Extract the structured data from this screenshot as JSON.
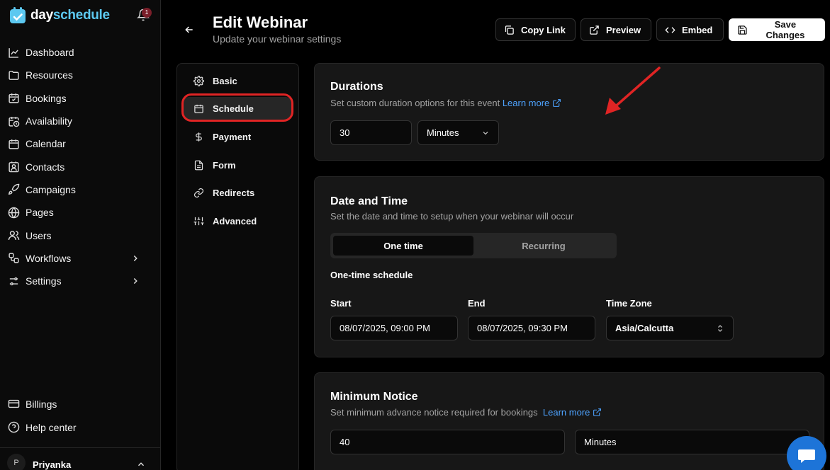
{
  "brand": {
    "part1": "day",
    "part2": "schedule"
  },
  "notifications": {
    "count": "1"
  },
  "sidebar": {
    "items": [
      {
        "label": "Dashboard",
        "icon": "chart-line-icon"
      },
      {
        "label": "Resources",
        "icon": "folder-icon"
      },
      {
        "label": "Bookings",
        "icon": "calendar-check-icon"
      },
      {
        "label": "Availability",
        "icon": "calendar-clock-icon"
      },
      {
        "label": "Calendar",
        "icon": "calendar-icon"
      },
      {
        "label": "Contacts",
        "icon": "contact-icon"
      },
      {
        "label": "Campaigns",
        "icon": "rocket-icon"
      },
      {
        "label": "Pages",
        "icon": "globe-icon"
      },
      {
        "label": "Users",
        "icon": "users-icon"
      },
      {
        "label": "Workflows",
        "icon": "workflow-icon"
      },
      {
        "label": "Settings",
        "icon": "sliders-icon"
      }
    ],
    "bottom": [
      {
        "label": "Billings",
        "icon": "credit-card-icon"
      },
      {
        "label": "Help center",
        "icon": "help-circle-icon"
      }
    ],
    "user": {
      "initial": "P",
      "name": "Priyanka"
    }
  },
  "header": {
    "title": "Edit Webinar",
    "subtitle": "Update your webinar settings",
    "buttons": {
      "copy_link": "Copy Link",
      "preview": "Preview",
      "embed": "Embed",
      "save": "Save Changes"
    }
  },
  "subnav": {
    "items": [
      {
        "label": "Basic",
        "icon": "gear-icon"
      },
      {
        "label": "Schedule",
        "icon": "calendar-icon",
        "active": true
      },
      {
        "label": "Payment",
        "icon": "dollar-icon"
      },
      {
        "label": "Form",
        "icon": "file-text-icon"
      },
      {
        "label": "Redirects",
        "icon": "link-icon"
      },
      {
        "label": "Advanced",
        "icon": "sliders-vertical-icon"
      }
    ]
  },
  "durations": {
    "title": "Durations",
    "desc": "Set custom duration options for this event",
    "learn_more": "Learn more",
    "value": "30",
    "unit": "Minutes"
  },
  "datetime": {
    "title": "Date and Time",
    "desc": "Set the date and time to setup when your webinar will occur",
    "tabs": {
      "one_time": "One time",
      "recurring": "Recurring"
    },
    "schedule_label": "One-time schedule",
    "start_label": "Start",
    "start_value": "08/07/2025, 09:00 PM",
    "end_label": "End",
    "end_value": "08/07/2025, 09:30 PM",
    "tz_label": "Time Zone",
    "tz_value": "Asia/Calcutta"
  },
  "notice": {
    "title": "Minimum Notice",
    "desc": "Set minimum advance notice required for bookings",
    "learn_more": "Learn more",
    "value": "40",
    "unit": "Minutes"
  },
  "colors": {
    "accent_link": "#4ea3ff",
    "highlight": "#e02424",
    "chat": "#1d74d8",
    "brand_cyan": "#5cc8f0"
  }
}
